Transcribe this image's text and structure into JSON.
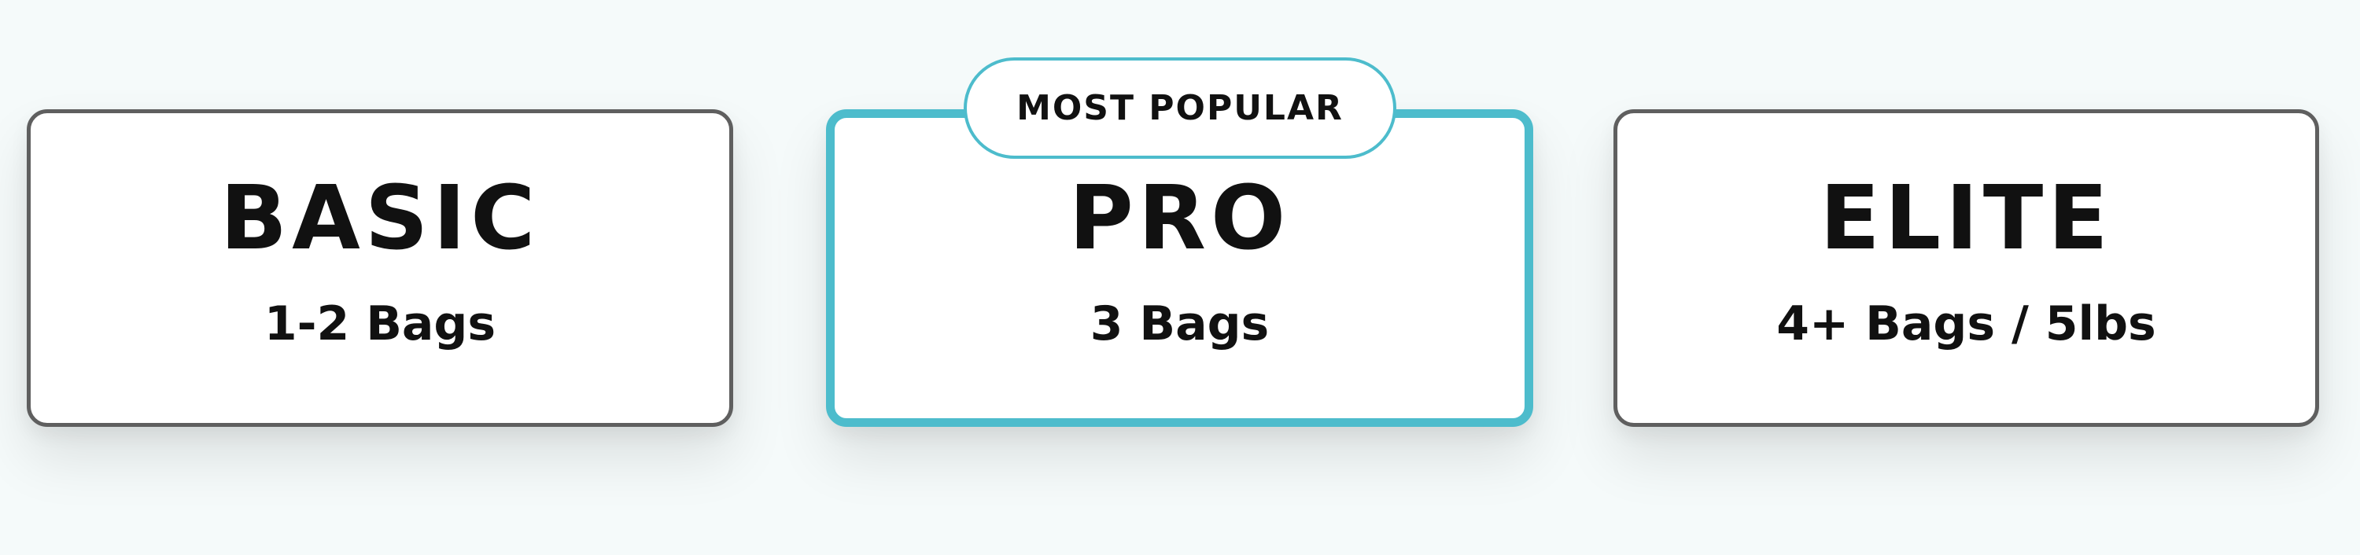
{
  "plans": [
    {
      "name": "BASIC",
      "description": "1-2 Bags"
    },
    {
      "name": "PRO",
      "description": "3 Bags",
      "badge": "MOST POPULAR"
    },
    {
      "name": "ELITE",
      "description": "4+ Bags / 5lbs"
    }
  ],
  "colors": {
    "background": "#f5fafa",
    "highlight_border": "#4dbccc",
    "default_border": "#5f5f5f",
    "text": "#111111"
  }
}
